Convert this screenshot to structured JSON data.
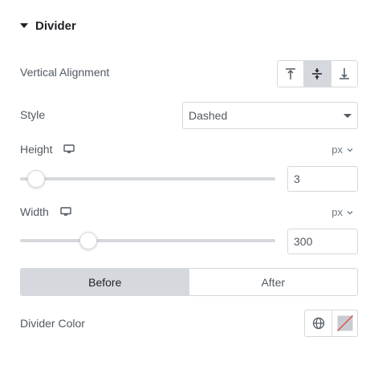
{
  "section": {
    "title": "Divider"
  },
  "vertical_alignment": {
    "label": "Vertical Alignment",
    "options": [
      {
        "name": "top",
        "icon": "align-top-icon",
        "active": false
      },
      {
        "name": "middle",
        "icon": "align-middle-icon",
        "active": true
      },
      {
        "name": "bottom",
        "icon": "align-bottom-icon",
        "active": false
      }
    ]
  },
  "style": {
    "label": "Style",
    "value": "Dashed"
  },
  "height": {
    "label": "Height",
    "unit": "px",
    "value": "3",
    "slider_fraction": 0.03,
    "device_icon": "desktop-icon"
  },
  "width": {
    "label": "Width",
    "unit": "px",
    "value": "300",
    "slider_fraction": 0.25,
    "device_icon": "desktop-icon"
  },
  "tabs": {
    "items": [
      "Before",
      "After"
    ],
    "active": "Before"
  },
  "divider_color": {
    "label": "Divider Color",
    "globe_icon": "globe-icon",
    "swatch": "no-color-swatch"
  },
  "colors": {
    "text": "#515962",
    "heading": "#1f2124",
    "border": "#d5d8dc",
    "active_bg": "#d5d8dc",
    "no_color_slash": "#e34b4b"
  }
}
